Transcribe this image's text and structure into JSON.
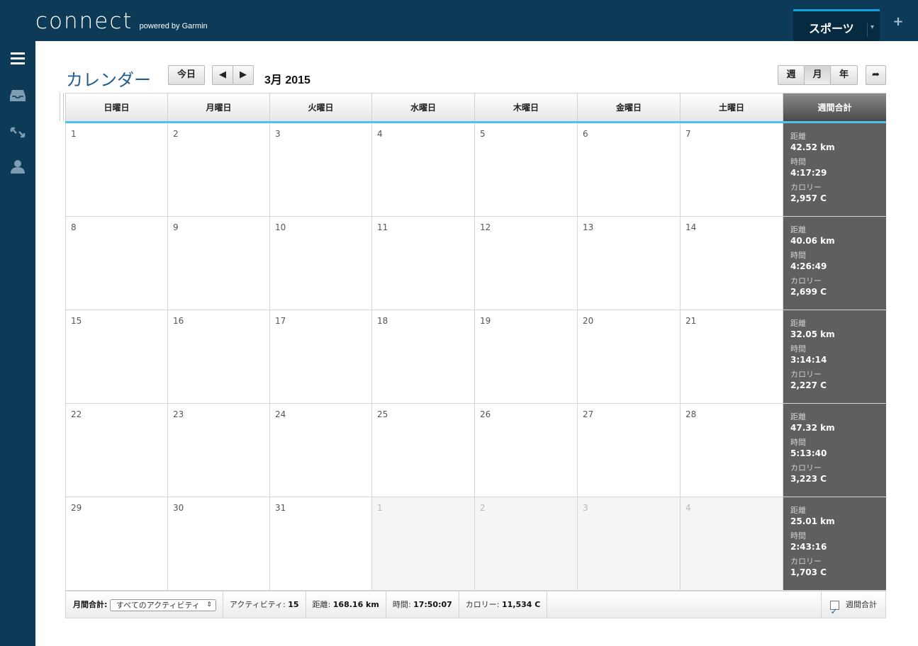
{
  "app": {
    "logo_main": "connect",
    "logo_sub": "powered by Garmin",
    "sport_tab": "スポーツ"
  },
  "toolbar": {
    "title": "カレンダー",
    "today": "今日",
    "month_label": "3月 2015",
    "view_week": "週",
    "view_month": "月",
    "view_year": "年"
  },
  "calendar": {
    "headers": [
      "日曜日",
      "月曜日",
      "火曜日",
      "水曜日",
      "木曜日",
      "金曜日",
      "土曜日",
      "週間合計"
    ],
    "rows": [
      {
        "days": [
          {
            "n": "1"
          },
          {
            "n": "2"
          },
          {
            "n": "3"
          },
          {
            "n": "4"
          },
          {
            "n": "5"
          },
          {
            "n": "6"
          },
          {
            "n": "7"
          }
        ],
        "total": {
          "distance": "42.52 km",
          "time": "4:17:29",
          "calories": "2,957 C"
        }
      },
      {
        "days": [
          {
            "n": "8"
          },
          {
            "n": "9"
          },
          {
            "n": "10"
          },
          {
            "n": "11"
          },
          {
            "n": "12"
          },
          {
            "n": "13"
          },
          {
            "n": "14"
          }
        ],
        "total": {
          "distance": "40.06 km",
          "time": "4:26:49",
          "calories": "2,699 C"
        }
      },
      {
        "days": [
          {
            "n": "15"
          },
          {
            "n": "16"
          },
          {
            "n": "17"
          },
          {
            "n": "18"
          },
          {
            "n": "19"
          },
          {
            "n": "20"
          },
          {
            "n": "21"
          }
        ],
        "total": {
          "distance": "32.05 km",
          "time": "3:14:14",
          "calories": "2,227 C"
        }
      },
      {
        "days": [
          {
            "n": "22"
          },
          {
            "n": "23"
          },
          {
            "n": "24"
          },
          {
            "n": "25"
          },
          {
            "n": "26"
          },
          {
            "n": "27"
          },
          {
            "n": "28"
          }
        ],
        "total": {
          "distance": "47.32 km",
          "time": "5:13:40",
          "calories": "3,223 C"
        }
      },
      {
        "days": [
          {
            "n": "29"
          },
          {
            "n": "30"
          },
          {
            "n": "31"
          },
          {
            "n": "1",
            "other": true
          },
          {
            "n": "2",
            "other": true
          },
          {
            "n": "3",
            "other": true
          },
          {
            "n": "4",
            "other": true
          }
        ],
        "total": {
          "distance": "25.01 km",
          "time": "2:43:16",
          "calories": "1,703 C"
        }
      }
    ],
    "total_labels": {
      "distance": "距離",
      "time": "時間",
      "calories": "カロリー"
    }
  },
  "footer": {
    "monthly_label": "月間合計:",
    "filter_value": "すべてのアクティビティ",
    "activities_label": "アクティビティ:",
    "activities_value": "15",
    "distance_label": "距離:",
    "distance_value": "168.16 km",
    "time_label": "時間:",
    "time_value": "17:50:07",
    "calories_label": "カロリー:",
    "calories_value": "11,534 C",
    "weekly_toggle": "週間合計"
  },
  "colors": {
    "nav_bg": "#0c3a57",
    "accent": "#12a0df",
    "title": "#1f5d8c",
    "total_bg": "#5f5f5f"
  }
}
